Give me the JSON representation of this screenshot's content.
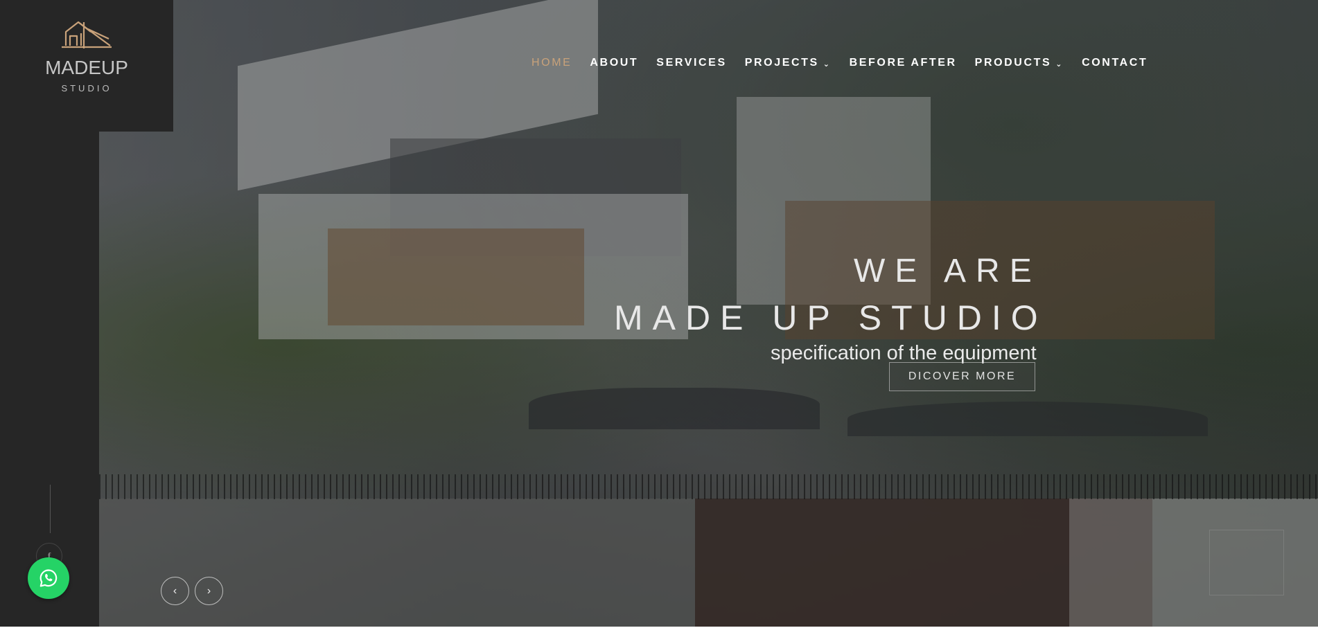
{
  "brand": {
    "name": "MADEUP",
    "tagline": "STUDIO",
    "logo_icon": "house-outline-icon",
    "accent_color": "#c9a27a"
  },
  "nav": {
    "items": [
      {
        "label": "HOME",
        "active": true
      },
      {
        "label": "ABOUT",
        "active": false
      },
      {
        "label": "SERVICES",
        "active": false
      },
      {
        "label": "PROJECTS",
        "active": false,
        "dropdown": true
      },
      {
        "label": "BEFORE AFTER",
        "active": false
      },
      {
        "label": "PRODUCTS",
        "active": false,
        "dropdown": true
      },
      {
        "label": "CONTACT",
        "active": false
      }
    ],
    "dropdown_icon": "chevron-down-icon"
  },
  "hero": {
    "title_line1": "WE ARE",
    "title_line2": "MADE UP STUDIO",
    "subtitle": "specification of the equipment",
    "cta_label": "DICOVER MORE"
  },
  "slider": {
    "prev_icon": "chevron-left-icon",
    "next_icon": "chevron-right-icon",
    "prev_glyph": "‹",
    "next_glyph": "›"
  },
  "social": {
    "facebook_glyph": "f",
    "facebook_icon": "facebook-icon"
  },
  "whatsapp": {
    "icon": "whatsapp-icon",
    "color": "#25d366"
  }
}
